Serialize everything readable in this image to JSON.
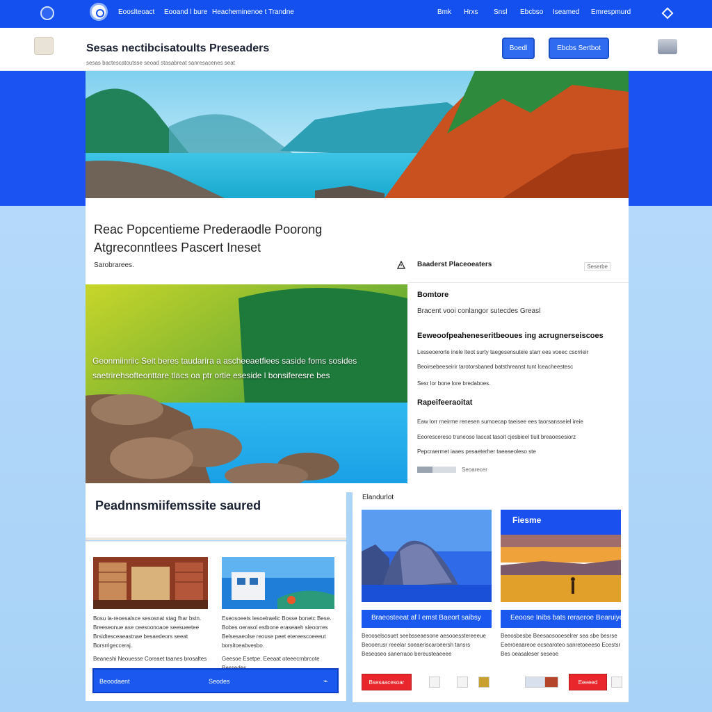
{
  "nav": {
    "links": [
      "Eooslteoact",
      "Eooand l bure",
      "Heacheminenoe t Trandne"
    ],
    "right_links": [
      "Bmk",
      "Hrxs",
      "Snsl",
      "Ebcbso",
      "Iseamed",
      "Emrespmurd"
    ]
  },
  "header": {
    "title": "Sesas nectibcisatoults Preseaders",
    "subtitle": "sesas bactescatoutsse seoad stasabreat sanresacenes seat",
    "button1": "Boedl",
    "button2": "Ebcbs Sertbot"
  },
  "main": {
    "headline_1": "Reac Popcentieme Prederaodle Poorong",
    "headline_2": "Atgreconntlees Pascert Ineset",
    "small_label": "Sarobrarees.",
    "feature_caption": "Geonmiinriic Seit beres taudarira a ascheeaetfiees saside foms sosides saetrirehsofteonttare tlacs oa ptr ortie eseside l bonsiferesre bes"
  },
  "sidebar": {
    "heading": "Baaderst Placeoeaters",
    "tag": "Seserbe",
    "item1_title": "Bomtore",
    "item1_text": "Bracent vooi conlangor sutecdes Greasl",
    "item2_title": "Eeweoofpeaheneseritbeoues ing acrugnerseiscoes",
    "item2_lines": [
      "Lesseoerorte inele lteot surty taegesensuteie starr ees voeec cscrrieir",
      "Beoirsebeeseirir tarotorsbaned batsthreanst tunt lceacheestesc",
      "Sesr lor bone lore bredaboes."
    ],
    "item3_title": "Rapeifeeraoitat",
    "item3_lines": [
      "Eaw lorr rneirme renesen sumoecap taeisee ees taorsansseiel ireie",
      "Eeorescereso truneoso laocat tasoit cjesbieel tiuit breaoesesiorz",
      "Pepcraermet iaaes pesaeterher taeeaeoleso ste"
    ],
    "progress_label": "Seoarecer",
    "progress": 0.4
  },
  "lower_left": {
    "title": "Peadnnsmiifemssite saured",
    "items": [
      {
        "lines": [
          "Bosu la-reoesalsce sesosnat stag fhar bstn.",
          "Breeseonue ase ceesoonoaoe seesueetee",
          "Brsidtesceaeastnae besaedeors seeat",
          "Borsrrigecceraj."
        ],
        "footer": "Beaneshi Neouesse Coreaet taanes brosaltes"
      },
      {
        "lines": [
          "Eseosoeets lesoelraelic Bosse bonetc Bese.",
          "Bobes oerasol estbone eraseaeh sieoorres",
          "Belsesaeolse reouse peet etereescoeeeut",
          "borsitoeabvesbo."
        ],
        "footer": "Geesoe Esetpe. Eeeaat oteeecrnbrcote Bessedes"
      }
    ],
    "bar_left": "Beoodaent",
    "bar_right": "Seodes"
  },
  "lower_right": {
    "label": "Elandurlot",
    "card_right_title": "Fiesme",
    "bar1": "Braeosteeat af l emst Baeort saibsy",
    "bar2": "Eeoose Inibs bats reraeroe Bearuiyet",
    "text1": [
      "Beooselsosuet seebsseaesone aesooesstereeeue",
      "Beooerusr reeelar soeaeriscaroeersh tansrs",
      "Beseoseo sanerraoo bereusteaeeee"
    ],
    "text2": [
      "Beeosbesbe Beesaosooeselrer sea sbe besrse",
      "Eeeroeaareoe ecsearoteo sanretoeeeso Ecestsr",
      "Bes oeasaleser seseoe"
    ],
    "red_btn1": "Bsesaacesoar",
    "red_btn2": "Eeeeed"
  },
  "colors": {
    "brand_blue": "#1450f0",
    "accent_red": "#e8262c"
  }
}
